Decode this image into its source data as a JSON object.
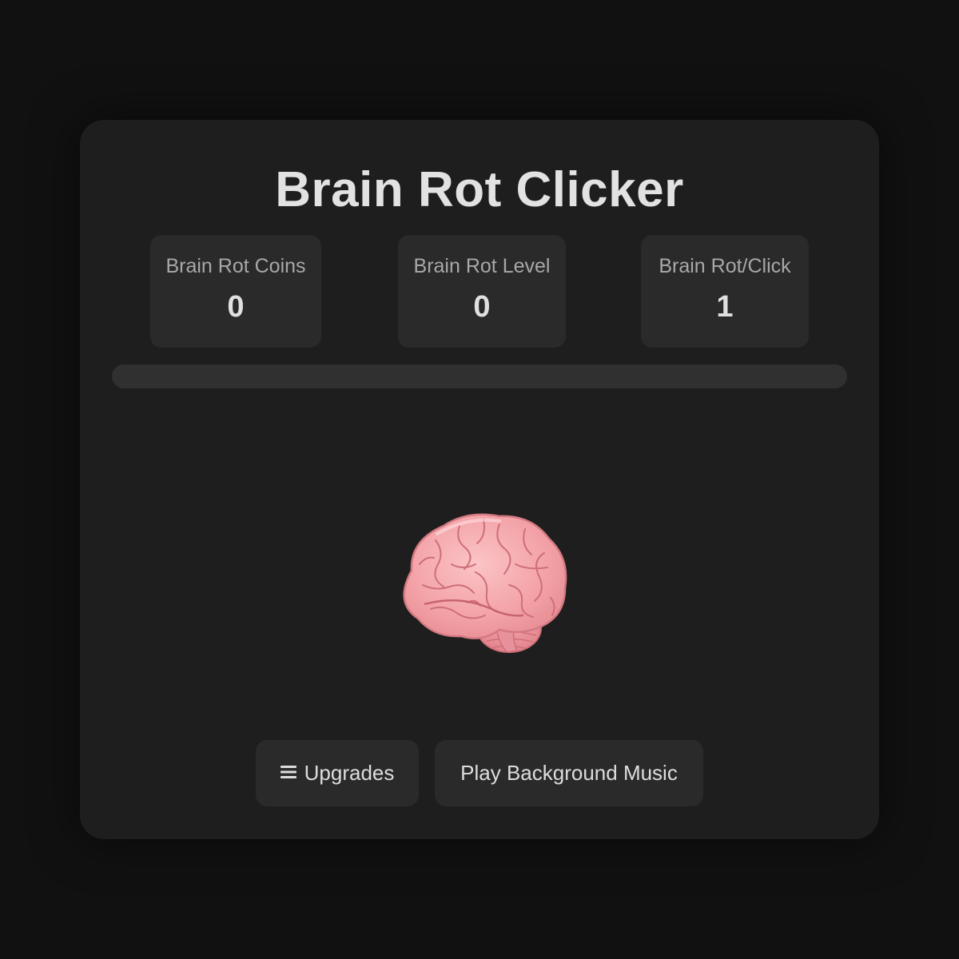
{
  "title": "Brain Rot Clicker",
  "stats": [
    {
      "label": "Brain Rot Coins",
      "value": "0"
    },
    {
      "label": "Brain Rot Level",
      "value": "0"
    },
    {
      "label": "Brain Rot/Click",
      "value": "1"
    }
  ],
  "progress": {
    "fraction": 0
  },
  "brain": {
    "icon": "brain-icon"
  },
  "buttons": {
    "upgrades_label": "Upgrades",
    "upgrades_icon": "menu-icon",
    "music_label": "Play Background Music"
  },
  "colors": {
    "background": "#111111",
    "panel": "#1e1e1e",
    "card": "#2a2a2a",
    "text": "#e2e2e2",
    "muted": "#a8a8a8",
    "brain_pink": "#f2a0a6"
  }
}
